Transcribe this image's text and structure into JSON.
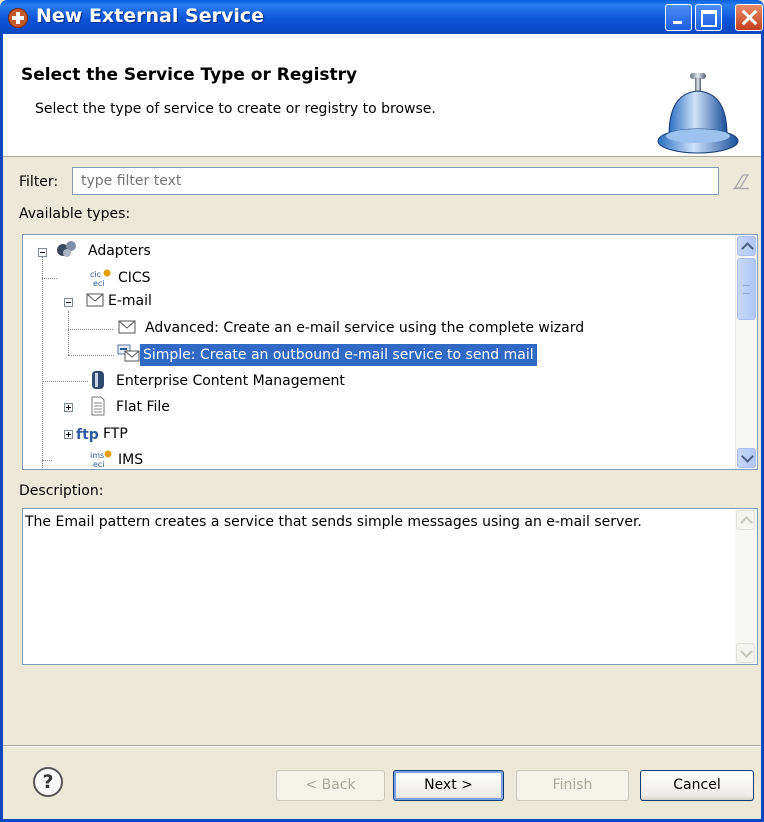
{
  "window": {
    "title": "New External Service"
  },
  "header": {
    "title": "Select the Service Type or Registry",
    "description": "Select the type of service to create or registry to browse."
  },
  "filter": {
    "label": "Filter:",
    "placeholder": "type filter text"
  },
  "types": {
    "label": "Available types:",
    "items": [
      {
        "label": "Adapters",
        "icon": "adapters-icon",
        "expanded": true
      },
      {
        "label": "CICS",
        "icon": "cics-eci-icon"
      },
      {
        "label": "E-mail",
        "icon": "envelope-icon",
        "expanded": true
      },
      {
        "label": "Advanced: Create an e-mail service using the complete wizard",
        "icon": "envelope-icon"
      },
      {
        "label": "Simple: Create an outbound e-mail service to send mail",
        "icon": "outbound-mail-icon",
        "selected": true
      },
      {
        "label": "Enterprise Content Management",
        "icon": "ecm-icon"
      },
      {
        "label": "Flat File",
        "icon": "file-icon",
        "expanded": false
      },
      {
        "label": "FTP",
        "icon": "ftp-icon",
        "expanded": false
      },
      {
        "label": "IMS",
        "icon": "ims-eci-icon"
      }
    ]
  },
  "description": {
    "label": "Description:",
    "text": "The Email pattern creates a service that sends simple messages using an e-mail server."
  },
  "buttons": {
    "back": "< Back",
    "next": "Next >",
    "finish": "Finish",
    "cancel": "Cancel"
  },
  "colors": {
    "selection": "#316ac5",
    "titlebar": "#0a5fe0",
    "dialog_bg": "#ece9d8"
  }
}
